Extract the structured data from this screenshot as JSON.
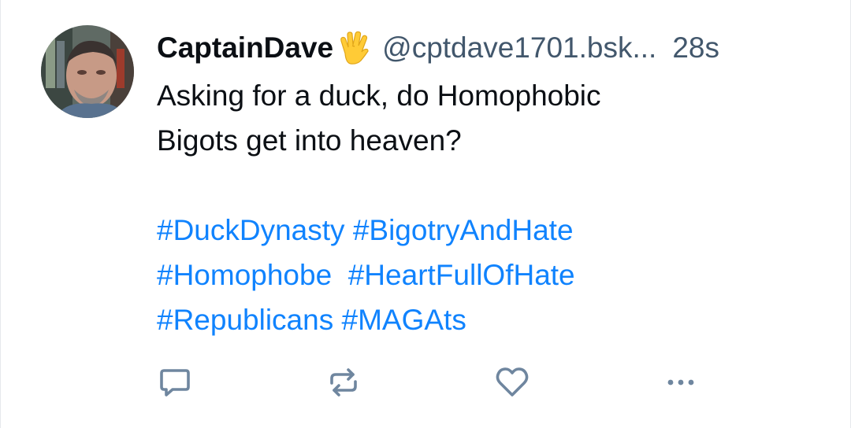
{
  "post": {
    "author": {
      "display_name": "CaptainDave",
      "name_emoji_icon": "vulcan-salute-icon",
      "handle": "@cptdave1701.bsk...",
      "avatar_icon": "user-avatar"
    },
    "timestamp": "28s",
    "text_lines": [
      "Asking for a duck, do Homophobic",
      "Bigots get into heaven?"
    ],
    "hashtags": [
      "#DuckDynasty",
      "#BigotryAndHate",
      "#Homophobe",
      "#HeartFullOfHate",
      "#Republicans",
      "#MAGAts"
    ]
  },
  "actions": [
    {
      "name": "reply",
      "icon": "comment-icon"
    },
    {
      "name": "repost",
      "icon": "repost-icon"
    },
    {
      "name": "like",
      "icon": "heart-icon"
    },
    {
      "name": "more",
      "icon": "more-dots-icon"
    }
  ],
  "colors": {
    "text": "#0b0f14",
    "secondary_text": "#42576c",
    "hashtag": "#1083fe",
    "icon": "#6f869f"
  }
}
